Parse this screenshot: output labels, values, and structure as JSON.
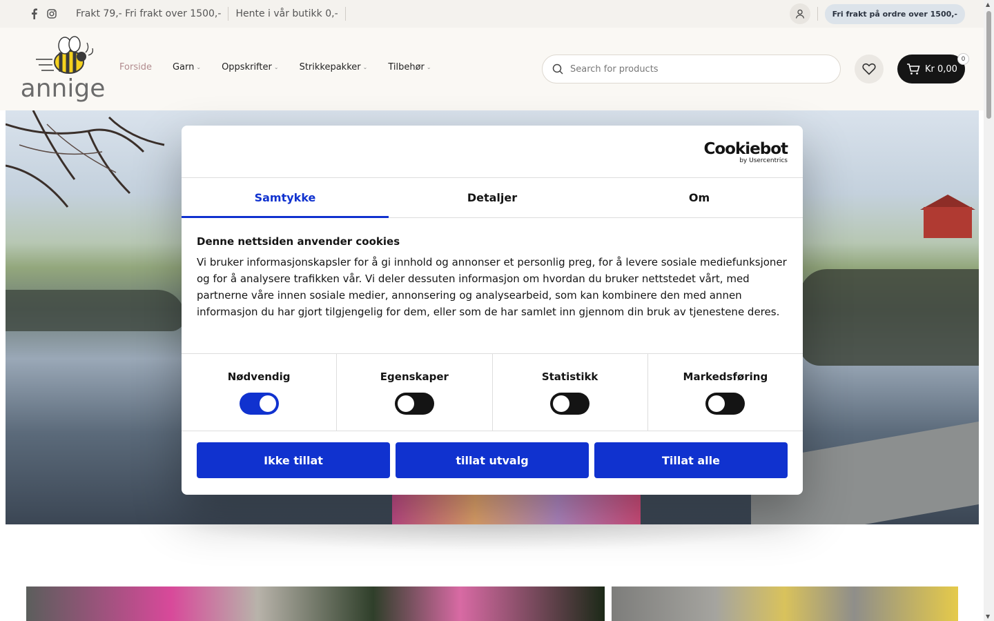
{
  "topbar": {
    "social": [
      "facebook-icon",
      "instagram-icon"
    ],
    "messages": [
      "Frakt 79,- Fri frakt over 1500,-",
      "Hente i vår butikk 0,-"
    ],
    "promo": "Fri frakt på ordre over 1500,-"
  },
  "header": {
    "logo_text": "annige",
    "nav": [
      {
        "label": "Forside",
        "active": true,
        "dropdown": false
      },
      {
        "label": "Garn",
        "active": false,
        "dropdown": true
      },
      {
        "label": "Oppskrifter",
        "active": false,
        "dropdown": true
      },
      {
        "label": "Strikkepakker",
        "active": false,
        "dropdown": true
      },
      {
        "label": "Tilbehør",
        "active": false,
        "dropdown": true
      }
    ],
    "search_placeholder": "Search for products",
    "cart_total": "Kr 0,00",
    "cart_count": "0"
  },
  "cookie": {
    "brand": "Cookiebot",
    "brand_sub": "by Usercentrics",
    "tabs": [
      "Samtykke",
      "Detaljer",
      "Om"
    ],
    "active_tab": "Samtykke",
    "heading": "Denne nettsiden anvender cookies",
    "text": "Vi bruker informasjonskapsler for å gi innhold og annonser et personlig preg, for å levere sosiale mediefunksjoner og for å analysere trafikken vår. Vi deler dessuten informasjon om hvordan du bruker nettstedet vårt, med partnerne våre innen sosiale medier, annonsering og analysearbeid, som kan kombinere den med annen informasjon du har gjort tilgjengelig for dem, eller som de har samlet inn gjennom din bruk av tjenestene deres.",
    "categories": [
      {
        "label": "Nødvendig",
        "on": true
      },
      {
        "label": "Egenskaper",
        "on": false
      },
      {
        "label": "Statistikk",
        "on": false
      },
      {
        "label": "Markedsføring",
        "on": false
      }
    ],
    "buttons": [
      "Ikke tillat",
      "tillat utvalg",
      "Tillat alle"
    ]
  },
  "colors": {
    "accent": "#1032cf",
    "nav_active": "#b18b8e",
    "cart_bg": "#151515",
    "topbar_bg": "#f4f2ee",
    "header_bg": "#faf8f4"
  }
}
